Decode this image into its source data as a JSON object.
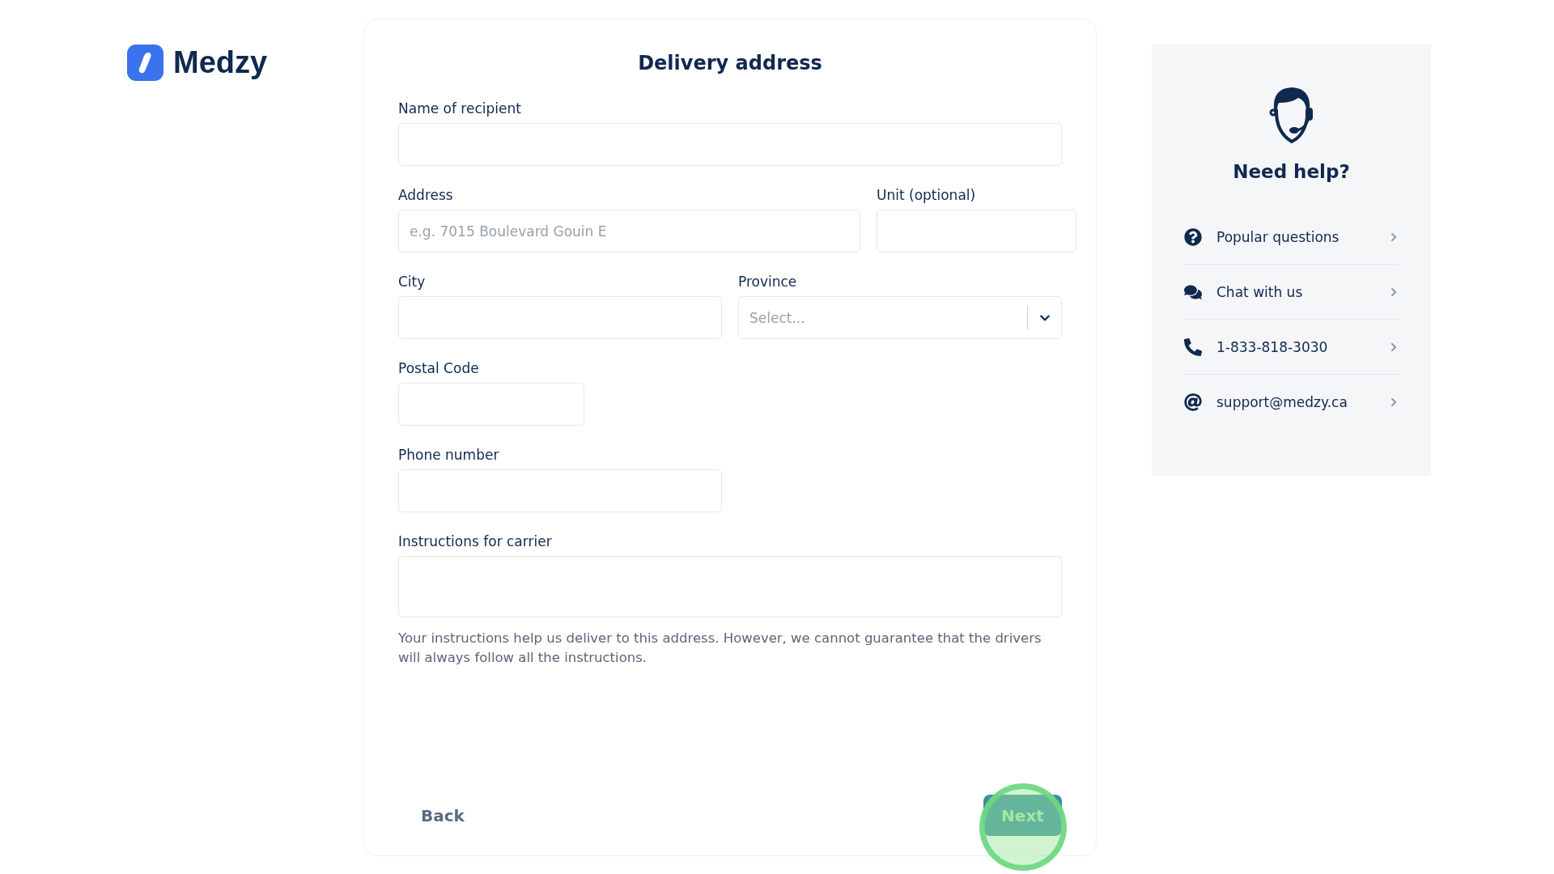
{
  "logo": {
    "name": "Medzy"
  },
  "form": {
    "title": "Delivery address",
    "rows": [
      [
        {
          "kind": "text",
          "label": "Name of recipient"
        }
      ],
      [
        {
          "kind": "text",
          "label": "Address",
          "placeholder": "e.g. 7015 Boulevard Gouin E"
        },
        {
          "kind": "text",
          "label": "Unit (optional)"
        }
      ],
      [
        {
          "kind": "text",
          "label": "City"
        },
        {
          "kind": "select",
          "label": "Province",
          "placeholder": "Select..."
        }
      ],
      [
        {
          "kind": "text",
          "label": "Postal Code"
        }
      ],
      [
        {
          "kind": "text",
          "label": "Phone number"
        }
      ],
      [
        {
          "kind": "textarea",
          "label": "Instructions for carrier"
        }
      ]
    ],
    "note": "Your instructions help us deliver to this address. However, we cannot guarantee that the drivers will always follow all the instructions.",
    "back": "Back",
    "next": "Next"
  },
  "help": {
    "title": "Need help?",
    "items": [
      {
        "kind": "question",
        "label": "Popular questions"
      },
      {
        "kind": "chat",
        "label": "Chat with us"
      },
      {
        "kind": "phone",
        "label": "1-833-818-3030"
      },
      {
        "kind": "email",
        "label": "support@medzy.ca"
      }
    ]
  }
}
